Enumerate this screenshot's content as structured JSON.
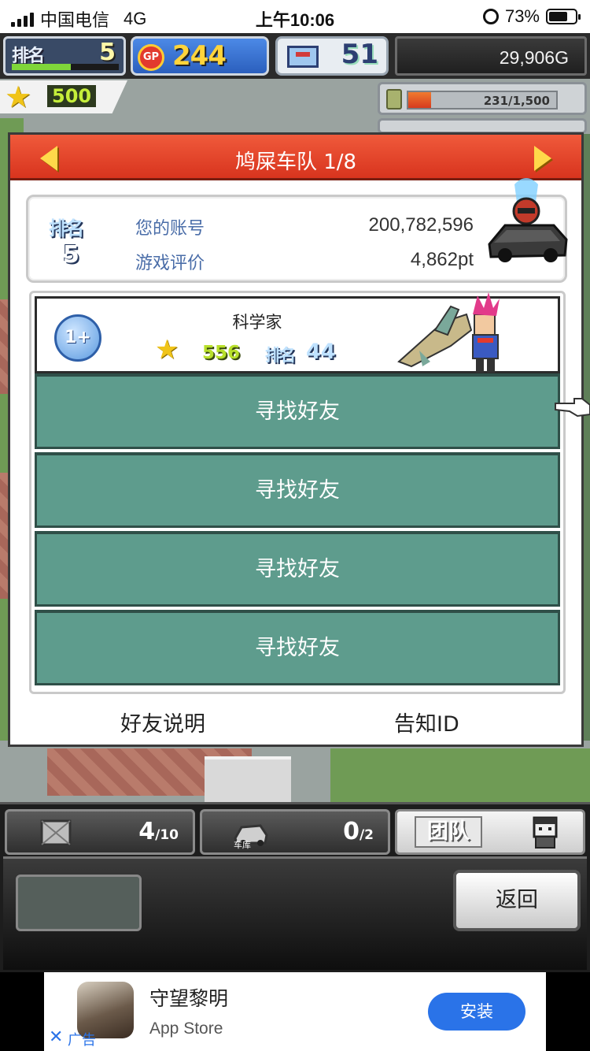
{
  "status_bar": {
    "carrier": "中国电信",
    "network": "4G",
    "time": "上午10:06",
    "battery": "73%",
    "battery_level": 0.73
  },
  "hud": {
    "rank_label": "排名",
    "rank_value": "5",
    "rank_progress": 0.55,
    "gp_label": "GP",
    "gp_value": "244",
    "pc_value": "51",
    "money": "29,906G",
    "stars": "500",
    "resource_text": "231/1,500",
    "resource_fraction": 0.154
  },
  "dialog": {
    "title": "鸠屎车队 1/8",
    "info": {
      "rank_label": "排名",
      "rank_value": "5",
      "account_label": "您的账号",
      "account_value": "200,782,596",
      "rating_label": "游戏评价",
      "rating_value": "4,862pt"
    },
    "member": {
      "level": "1+",
      "name": "科学家",
      "score": "556",
      "rank_label": "排名",
      "rank_value": "44"
    },
    "find_buttons": [
      "寻找好友",
      "寻找好友",
      "寻找好友",
      "寻找好友"
    ],
    "footer": {
      "friend_help": "好友说明",
      "notify_id": "告知ID"
    }
  },
  "bottom": {
    "tab1_count": "4",
    "tab1_total": "/10",
    "tab2_caption": "车库",
    "tab2_count": "0",
    "tab2_total": "/2",
    "team_label": "团队",
    "back": "返回"
  },
  "ad": {
    "title": "守望黎明",
    "subtitle": "App Store",
    "install": "安装",
    "close": "✕",
    "label": "广告"
  },
  "colors": {
    "header_red": "#d8341e",
    "find_button": "#5e9c8d",
    "link_blue": "#4a6da8",
    "install_blue": "#2a73e8"
  }
}
